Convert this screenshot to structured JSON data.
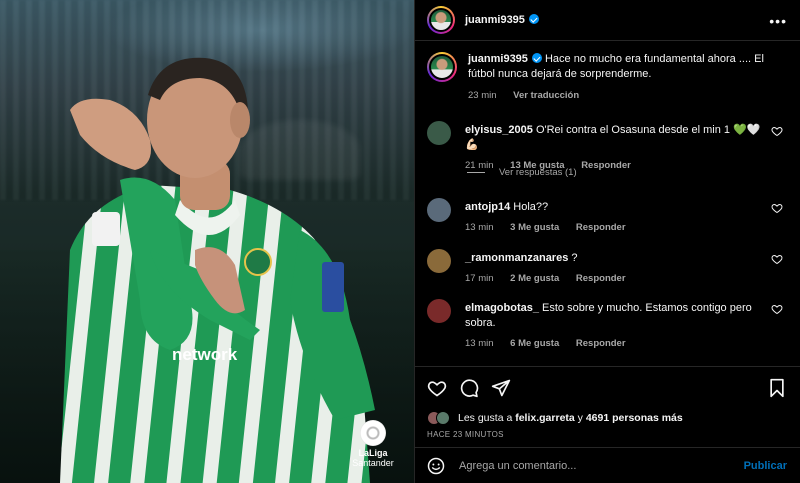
{
  "post": {
    "author": "juanmi9395",
    "more_icon": "more-horizontal-icon",
    "watermark": {
      "line1": "LaLiga",
      "line2": "Santander"
    },
    "jersey_text": "network"
  },
  "caption": {
    "username": "juanmi9395",
    "text": "Hace no mucho era fundamental ahora .... El fútbol nunca dejará de sorprenderme.",
    "time": "23 min",
    "translate": "Ver traducción"
  },
  "comments": [
    {
      "username": "elyisus_2005",
      "text": "O'Rei contra el Osasuna desde el min 1 💚🤍💪🏻",
      "time": "21 min",
      "likes": "13 Me gusta",
      "reply": "Responder",
      "avatar_color": "#3a5a48"
    },
    {
      "username": "antojp14",
      "text": "Hola??",
      "time": "13 min",
      "likes": "3 Me gusta",
      "reply": "Responder",
      "avatar_color": "#5a6a7a"
    },
    {
      "username": "_ramonmanzanares",
      "text": "?",
      "time": "17 min",
      "likes": "2 Me gusta",
      "reply": "Responder",
      "avatar_color": "#8a6a3a"
    },
    {
      "username": "elmagobotas_",
      "text": "Esto sobre y mucho. Estamos contigo pero sobra.",
      "time": "13 min",
      "likes": "6 Me gusta",
      "reply": "Responder",
      "avatar_color": "#7a2a2a"
    }
  ],
  "view_replies": "Ver respuestas (1)",
  "actions": {
    "icons": [
      "heart-icon",
      "comment-icon",
      "share-icon",
      "bookmark-icon"
    ]
  },
  "likes": {
    "prefix": "Les gusta a",
    "user": "felix.garreta",
    "mid": "y",
    "count": "4691 personas más"
  },
  "date": "HACE 23 MINUTOS",
  "composer": {
    "placeholder": "Agrega un comentario...",
    "publish": "Publicar"
  },
  "colors": {
    "accent": "#0095f6",
    "secondary_text": "#a8a8a8",
    "divider": "#262626"
  }
}
